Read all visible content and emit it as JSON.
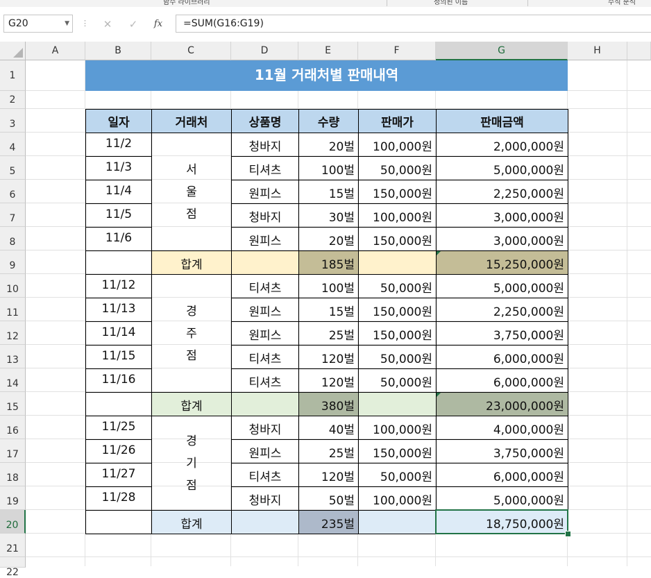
{
  "ribbon": {
    "labels": [
      "함수 라이브러리",
      "정의된 이름",
      "수식 분석"
    ]
  },
  "formula_bar": {
    "name_box": "G20",
    "cancel_icon": "✕",
    "enter_icon": "✓",
    "fx_label": "fx",
    "formula": "=SUM(G16:G19)"
  },
  "columns": [
    "A",
    "B",
    "C",
    "D",
    "E",
    "F",
    "G",
    "H"
  ],
  "selected_column": "G",
  "rows": [
    "1",
    "2",
    "3",
    "4",
    "5",
    "6",
    "7",
    "8",
    "9",
    "10",
    "11",
    "12",
    "13",
    "14",
    "15",
    "16",
    "17",
    "18",
    "19",
    "20",
    "21",
    "22"
  ],
  "selected_row": "20",
  "sheet": {
    "title": "11월 거래처별 판매내역",
    "headers": [
      "일자",
      "거래처",
      "상품명",
      "수량",
      "판매가",
      "판매금액"
    ],
    "groups": [
      {
        "store": "서울점",
        "rows": [
          {
            "date": "11/2",
            "product": "청바지",
            "qty": "20벌",
            "price": "100,000원",
            "amount": "2,000,000원"
          },
          {
            "date": "11/3",
            "product": "티셔츠",
            "qty": "100벌",
            "price": "50,000원",
            "amount": "5,000,000원"
          },
          {
            "date": "11/4",
            "product": "원피스",
            "qty": "15벌",
            "price": "150,000원",
            "amount": "2,250,000원"
          },
          {
            "date": "11/5",
            "product": "청바지",
            "qty": "30벌",
            "price": "100,000원",
            "amount": "3,000,000원"
          },
          {
            "date": "11/6",
            "product": "원피스",
            "qty": "20벌",
            "price": "150,000원",
            "amount": "3,000,000원"
          }
        ],
        "total_label": "합계",
        "total_qty": "185벌",
        "total_amount": "15,250,000원",
        "fill_color": "#fff2cc",
        "sum_color": "#c4bd97"
      },
      {
        "store": "경주점",
        "rows": [
          {
            "date": "11/12",
            "product": "티셔츠",
            "qty": "100벌",
            "price": "50,000원",
            "amount": "5,000,000원"
          },
          {
            "date": "11/13",
            "product": "원피스",
            "qty": "15벌",
            "price": "150,000원",
            "amount": "2,250,000원"
          },
          {
            "date": "11/14",
            "product": "원피스",
            "qty": "25벌",
            "price": "150,000원",
            "amount": "3,750,000원"
          },
          {
            "date": "11/15",
            "product": "티셔츠",
            "qty": "120벌",
            "price": "50,000원",
            "amount": "6,000,000원"
          },
          {
            "date": "11/16",
            "product": "티셔츠",
            "qty": "120벌",
            "price": "50,000원",
            "amount": "6,000,000원"
          }
        ],
        "total_label": "합계",
        "total_qty": "380벌",
        "total_amount": "23,000,000원",
        "fill_color": "#e2efda",
        "sum_color": "#aeb9a2"
      },
      {
        "store": "경기점",
        "rows": [
          {
            "date": "11/25",
            "product": "청바지",
            "qty": "40벌",
            "price": "100,000원",
            "amount": "4,000,000원"
          },
          {
            "date": "11/26",
            "product": "원피스",
            "qty": "25벌",
            "price": "150,000원",
            "amount": "3,750,000원"
          },
          {
            "date": "11/27",
            "product": "티셔츠",
            "qty": "120벌",
            "price": "50,000원",
            "amount": "6,000,000원"
          },
          {
            "date": "11/28",
            "product": "청바지",
            "qty": "50벌",
            "price": "100,000원",
            "amount": "5,000,000원"
          }
        ],
        "total_label": "합계",
        "total_qty": "235벌",
        "total_amount": "18,750,000원",
        "fill_color": "#ddebf7",
        "sum_color": "#adb9ca"
      }
    ]
  },
  "colors": {
    "title_fill": "#5b9bd5",
    "header_fill": "#bdd7ee",
    "selection": "#217346"
  }
}
